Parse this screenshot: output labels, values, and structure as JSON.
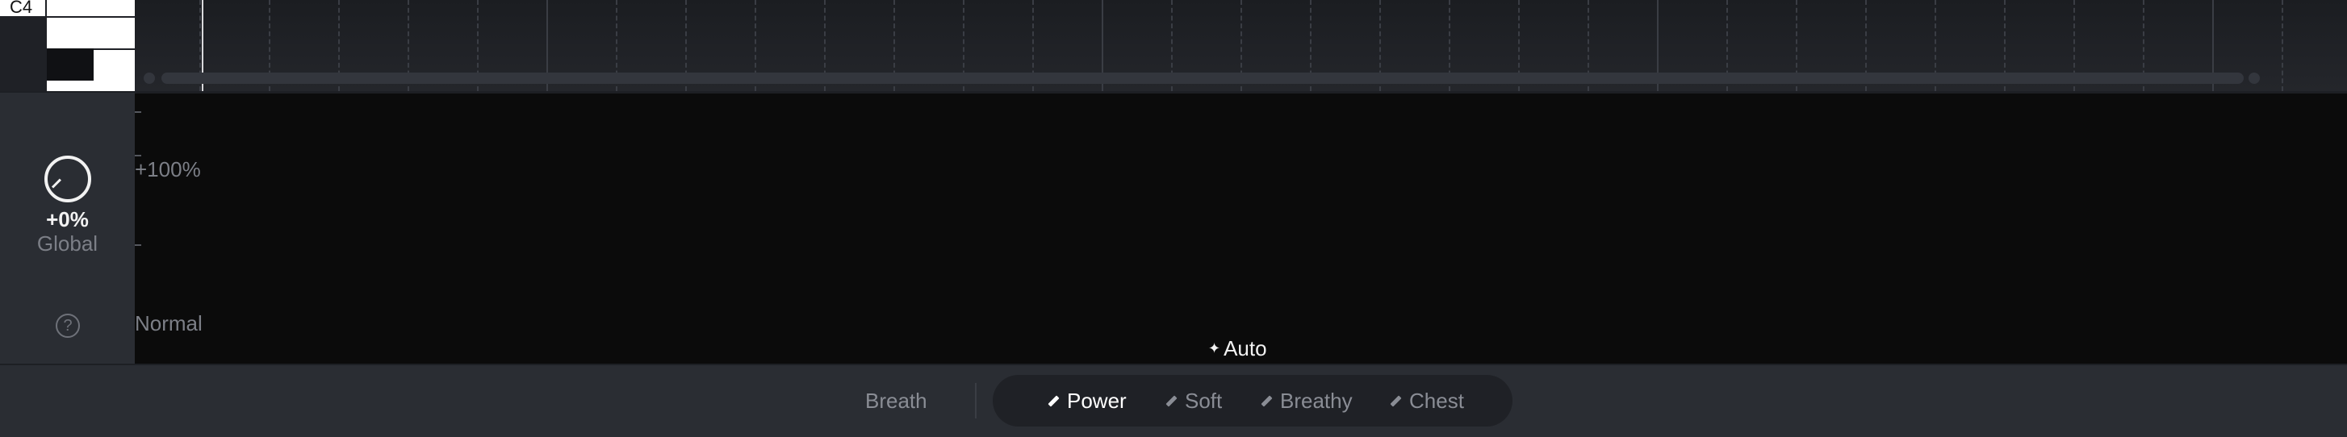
{
  "piano": {
    "note_label": "C4"
  },
  "side_panel": {
    "knob_value": "+0%",
    "knob_label": "Global",
    "help_glyph": "?"
  },
  "lane": {
    "top_label": "+100%",
    "bottom_label": "Normal",
    "auto_label": "Auto",
    "auto_icon": "sparkle-icon"
  },
  "modes": {
    "breath_label": "Breath",
    "items": [
      {
        "label": "Power",
        "icon": "pencil-icon",
        "active": true
      },
      {
        "label": "Soft",
        "icon": "pencil-icon",
        "active": false
      },
      {
        "label": "Breathy",
        "icon": "pencil-icon",
        "active": false
      },
      {
        "label": "Chest",
        "icon": "pencil-icon",
        "active": false
      }
    ]
  },
  "colors": {
    "background": "#26292f",
    "lane_background": "#0b0b0b",
    "active_text": "#ffffff",
    "inactive_text": "#8a8d95"
  }
}
